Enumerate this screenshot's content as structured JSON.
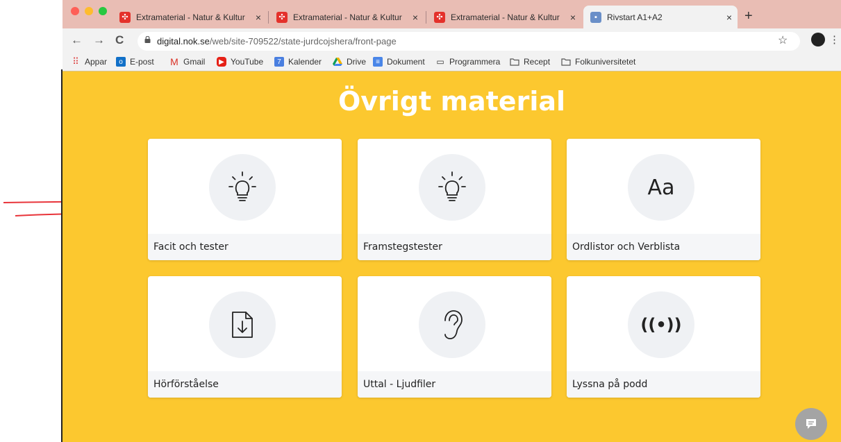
{
  "tabs": [
    {
      "title": "Extramaterial - Natur & Kultur",
      "close": "×"
    },
    {
      "title": "Extramaterial - Natur & Kultur",
      "close": "×"
    },
    {
      "title": "Extramaterial - Natur & Kultur",
      "close": "×"
    },
    {
      "title": "Rivstart A1+A2",
      "close": "×",
      "active": true
    }
  ],
  "new_tab": "+",
  "toolbar": {
    "back": "←",
    "forward": "→",
    "reload": "C",
    "url_domain": "digital.nok.se",
    "url_path": "/web/site-709522/state-jurdcojshera/front-page",
    "star": "☆",
    "menu": "⋮"
  },
  "bookmarks": [
    {
      "label": "Appar",
      "icon": "apps-grid-icon"
    },
    {
      "label": "E-post",
      "icon": "outlook-icon"
    },
    {
      "label": "Gmail",
      "icon": "gmail-icon"
    },
    {
      "label": "YouTube",
      "icon": "youtube-icon"
    },
    {
      "label": "Kalender",
      "icon": "calendar-icon"
    },
    {
      "label": "Drive",
      "icon": "drive-icon"
    },
    {
      "label": "Dokument",
      "icon": "docs-icon"
    },
    {
      "label": "Programmera",
      "icon": "monitor-icon"
    },
    {
      "label": "Recept",
      "icon": "folder-icon"
    },
    {
      "label": "Folkuniversitetet",
      "icon": "folder-icon"
    }
  ],
  "page": {
    "heading": "Övrigt material",
    "cards": [
      {
        "label": "Facit och tester",
        "icon": "lightbulb-icon"
      },
      {
        "label": "Framstegstester",
        "icon": "lightbulb-icon"
      },
      {
        "label": "Ordlistor och Verblista",
        "icon": "text-aa-icon",
        "icon_text": "Aa"
      },
      {
        "label": "Hörförståelse",
        "icon": "download-document-icon"
      },
      {
        "label": "Uttal - Ljudfiler",
        "icon": "ear-icon"
      },
      {
        "label": "Lyssna på podd",
        "icon": "broadcast-icon",
        "icon_text": "((•))"
      }
    ]
  },
  "colors": {
    "page_background": "#fcc82f",
    "tab_strip": "#e9bdb4",
    "annotation_arrow": "#e8343a"
  }
}
